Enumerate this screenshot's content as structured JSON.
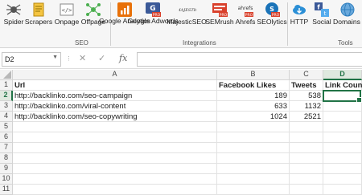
{
  "ribbon": {
    "buttons": [
      {
        "label": "Spider",
        "icon": "spider-icon",
        "color": "#7a7a7a"
      },
      {
        "label": "Scrapers",
        "icon": "scrapers-icon",
        "color": "#e0a400"
      },
      {
        "label": "Onpage",
        "icon": "onpage-icon",
        "color": "#7a7a7a"
      },
      {
        "label": "Offpage",
        "icon": "offpage-icon",
        "color": "#4caf50"
      },
      {
        "label": "Google Analytics",
        "icon": "google-analytics-icon",
        "color": "#e8710a"
      },
      {
        "label": "Google Adwords",
        "icon": "google-adwords-icon",
        "color": "#3b5998"
      },
      {
        "label": "MajesticSEO",
        "icon": "majesticseo-icon",
        "color": "#444"
      },
      {
        "label": "SEMrush",
        "icon": "semrush-icon",
        "color": "#d9402b"
      },
      {
        "label": "Ahrefs",
        "icon": "ahrefs-icon",
        "color": "#e8710a"
      },
      {
        "label": "SEOlytics",
        "icon": "seolytics-icon",
        "color": "#2196f3"
      },
      {
        "label": "HTTP",
        "icon": "cloud-icon",
        "color": "#2b8fd6"
      },
      {
        "label": "Social",
        "icon": "social-icon",
        "color": "#3b5998"
      },
      {
        "label": "Domains",
        "icon": "globe-icon",
        "color": "#2f7fbf"
      }
    ],
    "groups": {
      "seo": "SEO",
      "integrations": "Integrations",
      "tools": "Tools"
    },
    "pro_badge": "PRO",
    "accent": "#217346"
  },
  "formula_bar": {
    "name_box": "D2",
    "cancel": "✕",
    "enter": "✓",
    "fx": "fx",
    "value": ""
  },
  "sheet": {
    "columns": [
      "A",
      "B",
      "C",
      "D"
    ],
    "rows": [
      "1",
      "2",
      "3",
      "4",
      "5",
      "6",
      "7",
      "8",
      "9",
      "10",
      "11"
    ],
    "headers": [
      "Url",
      "Facebook Likes",
      "Tweets",
      "Link Count"
    ],
    "data": [
      {
        "url": "http://backlinko.com/seo-campaign",
        "likes": "189",
        "tweets": "538",
        "links": ""
      },
      {
        "url": "http://backlinko.com/viral-content",
        "likes": "633",
        "tweets": "1132",
        "links": ""
      },
      {
        "url": "http://backlinko.com/seo-copywriting",
        "likes": "1024",
        "tweets": "2521",
        "links": ""
      }
    ],
    "selected_cell": "D2"
  }
}
